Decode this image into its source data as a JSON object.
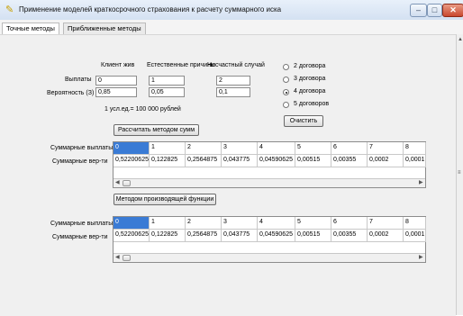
{
  "window": {
    "title": "Применение моделей краткосрочного страхования к расчету суммарного иска",
    "app_icon": "app-icon",
    "minimize_label": "–",
    "maximize_label": "□",
    "close_label": "✕"
  },
  "tabs": [
    {
      "label": "Точные методы"
    },
    {
      "label": "Приближенные методы"
    }
  ],
  "form": {
    "col_headers": [
      "Клиент жив",
      "Естественные причины",
      "Несчастный случай"
    ],
    "row_payments_label": "Выплаты",
    "row_prob_label": "Вероятность (З)",
    "payments": [
      "0",
      "1",
      "2"
    ],
    "probabilities": [
      "0,85",
      "0,05",
      "0,1"
    ],
    "unit_note": "1 усл.ед.= 100 000 рублей",
    "radio_options": [
      {
        "label": "2 договора",
        "selected": false
      },
      {
        "label": "3 договора",
        "selected": false
      },
      {
        "label": "4 договора",
        "selected": true
      },
      {
        "label": "5 договоров",
        "selected": false
      }
    ],
    "clear_button": "Очистить",
    "calc_button": "Рассчитать методом сумм",
    "gen_button": "Методом производящей функции"
  },
  "table1": {
    "row1_label": "Суммарные выплаты",
    "row2_label": "Суммарные вер-ти",
    "payments": [
      "0",
      "1",
      "2",
      "3",
      "4",
      "5",
      "6",
      "7",
      "8"
    ],
    "probs": [
      "0,52200625",
      "0,122825",
      "0,2564875",
      "0,043775",
      "0,04590625",
      "0,00515",
      "0,00355",
      "0,0002",
      "0,0001"
    ]
  },
  "table2": {
    "row1_label": "Суммарные выплаты",
    "row2_label": "Суммарные вер-ти",
    "payments": [
      "0",
      "1",
      "2",
      "3",
      "4",
      "5",
      "6",
      "7",
      "8"
    ],
    "probs": [
      "0,52200625",
      "0,122825",
      "0,2564875",
      "0,043775",
      "0,04590625",
      "0,00515",
      "0,00355",
      "0,0002",
      "0,0001"
    ]
  },
  "colors": {
    "accent": "#3a7bd5",
    "panel": "#f0f0f0"
  }
}
